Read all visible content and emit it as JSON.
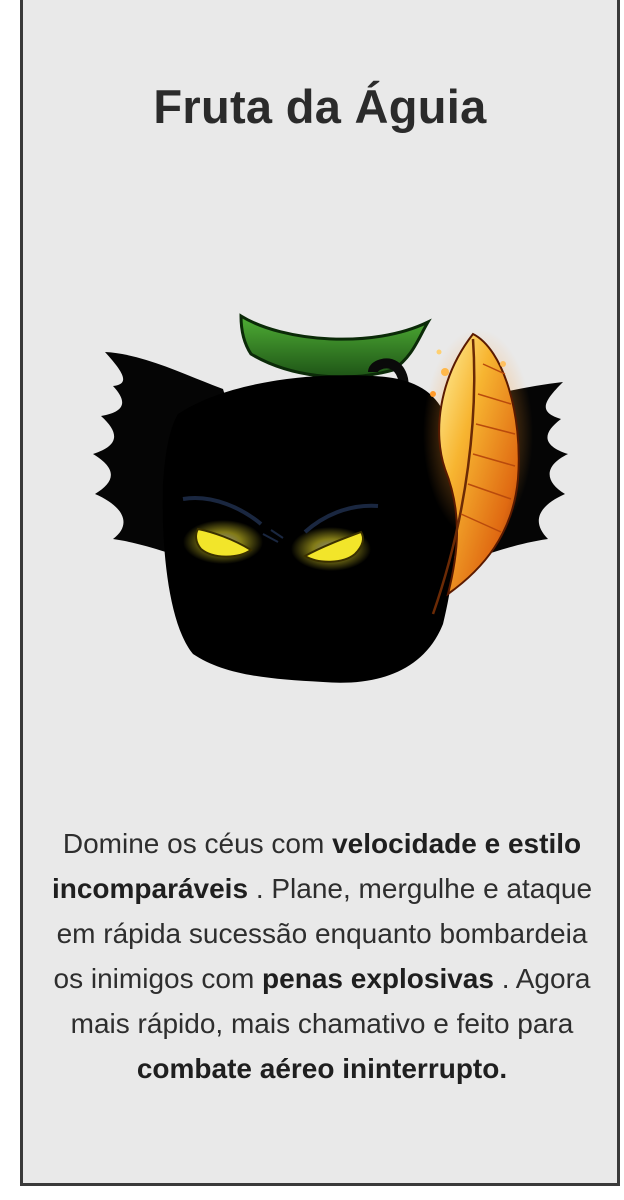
{
  "card": {
    "title": "Fruta da Águia",
    "image": {
      "icon": "eagle-fruit-icon",
      "eye_color": "#f2e52a",
      "feather_color": "#f0a020",
      "leaf_color": "#2e7a22"
    },
    "description": {
      "t1": "Domine os céus com ",
      "b1": "velocidade e estilo incomparáveis",
      "t2": " . Plane, mergulhe e ataque em rápida sucessão enquanto bombardeia os inimigos com ",
      "b2": "penas explosivas",
      "t3": " . Agora mais rápido, mais chamativo e feito para ",
      "b3": "combate aéreo ininterrupto."
    }
  }
}
